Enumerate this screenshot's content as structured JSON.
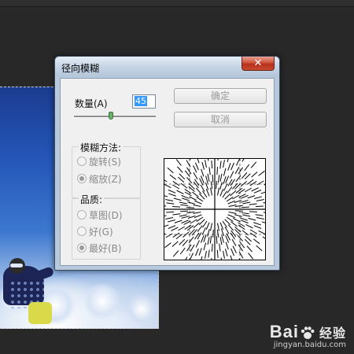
{
  "dialog": {
    "title": "径向模糊",
    "close_icon": "close-icon",
    "amount_label": "数量(A)",
    "amount_value": "45",
    "amount_slider_fraction": 0.45,
    "ok_label": "确定",
    "cancel_label": "取消",
    "blur_method": {
      "title": "模糊方法:",
      "options": [
        {
          "label": "旋转(S)",
          "selected": false
        },
        {
          "label": "缩放(Z)",
          "selected": true
        }
      ]
    },
    "quality": {
      "title": "品质:",
      "options": [
        {
          "label": "草图(D)",
          "selected": false
        },
        {
          "label": "好(G)",
          "selected": false
        },
        {
          "label": "最好(B)",
          "selected": true
        }
      ]
    }
  },
  "watermark": {
    "logo_text_left": "Bai",
    "logo_text_right": "经验",
    "url": "jingyan.baidu.com",
    "icon": "baidu-paw-icon"
  },
  "colors": {
    "workspace_bg": "#282828",
    "close_button": "#c74830",
    "selection_highlight": "#3399ff"
  }
}
